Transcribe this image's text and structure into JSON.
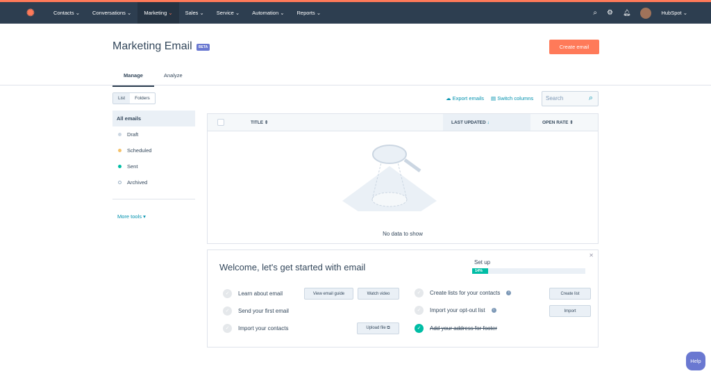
{
  "nav": {
    "items": [
      "Contacts",
      "Conversations",
      "Marketing",
      "Sales",
      "Service",
      "Automation",
      "Reports"
    ],
    "active": "Marketing",
    "account": "HubSpot"
  },
  "header": {
    "title": "Marketing Email",
    "badge": "BETA",
    "create": "Create email"
  },
  "tabs": [
    "Manage",
    "Analyze"
  ],
  "view_toggle": [
    "List",
    "Folders"
  ],
  "sidebar": {
    "all": "All emails",
    "items": [
      {
        "label": "Draft",
        "color": "#cbd6e2"
      },
      {
        "label": "Scheduled",
        "color": "#f5c26b"
      },
      {
        "label": "Sent",
        "color": "#00bda5"
      },
      {
        "label": "Archived",
        "color": "#ffffff"
      }
    ],
    "more": "More tools"
  },
  "actions": {
    "export": "Export emails",
    "columns": "Switch columns",
    "search_placeholder": "Search"
  },
  "table": {
    "columns": [
      "TITLE",
      "LAST UPDATED",
      "OPEN RATE"
    ],
    "empty": "No data to show"
  },
  "welcome": {
    "title": "Welcome, let's get started with email",
    "setup": "Set up",
    "progress": "14%",
    "tasks": {
      "learn": "Learn about email",
      "send": "Send your first email",
      "import_contacts": "Import your contacts",
      "lists": "Create lists for your contacts",
      "optout": "Import your opt-out list",
      "address": "Add your address for footer"
    },
    "buttons": {
      "guide": "View email guide",
      "video": "Watch video",
      "upload": "Upload file ⧉",
      "create_list": "Create list",
      "import": "Import"
    }
  },
  "help": "Help"
}
